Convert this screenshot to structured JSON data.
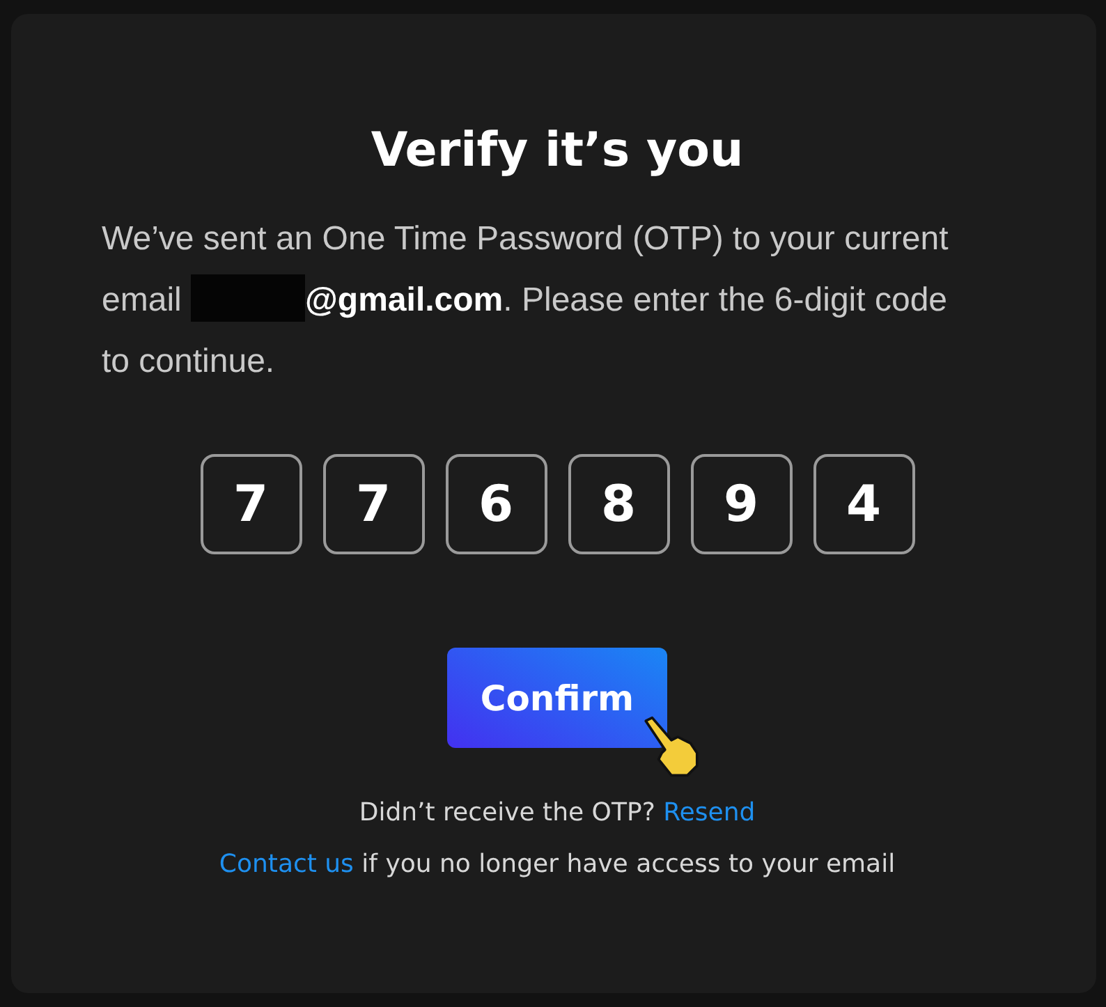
{
  "dialog": {
    "title": "Verify it’s you",
    "message": {
      "before": "We’ve sent an One Time Password (OTP) to your current email ",
      "redacted": true,
      "after": "**@gmail.com**. Please enter the 6-digit code to continue."
    },
    "code_digits": [
      "7",
      "7",
      "6",
      "8",
      "9",
      "4"
    ],
    "confirm_button": "Confirm",
    "resend_line": {
      "text": "Didn’t receive the OTP?",
      "link": "Resend"
    },
    "contact_line": {
      "link": "Contact us",
      "text": "if you no longer have access to your email"
    }
  }
}
